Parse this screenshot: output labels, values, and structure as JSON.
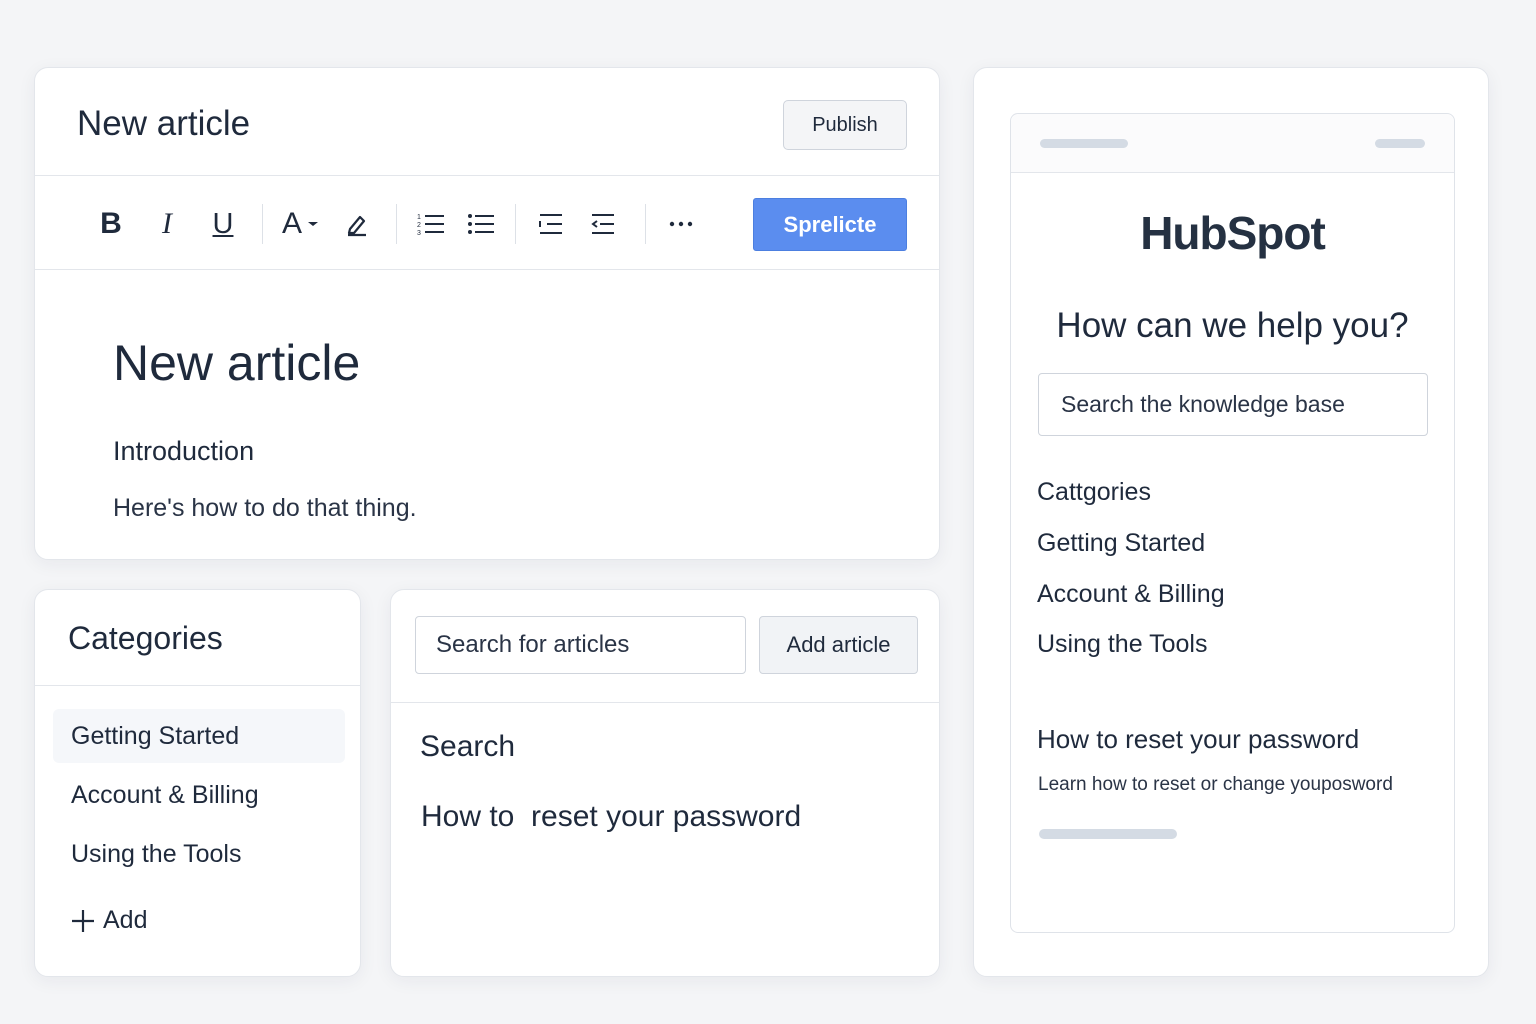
{
  "editor": {
    "header_title": "New article",
    "publish_label": "Publish",
    "primary_button_label": "Sprelicte",
    "toolbar": {
      "bold": "B",
      "italic": "I",
      "underline": "U",
      "font": "A",
      "icons": [
        "bold-icon",
        "italic-icon",
        "underline-icon",
        "font-color-icon",
        "highlight-icon",
        "ordered-list-icon",
        "bulleted-list-icon",
        "indent-icon",
        "outdent-icon",
        "more-icon"
      ]
    },
    "document": {
      "title": "New article",
      "heading": "Introduction",
      "paragraph": "Here's how to do that thing."
    }
  },
  "categories": {
    "title": "Categories",
    "items": [
      {
        "label": "Getting Started",
        "active": true
      },
      {
        "label": "Account & Billing",
        "active": false
      },
      {
        "label": "Using the Tools",
        "active": false
      }
    ],
    "add_label": "Add"
  },
  "search": {
    "placeholder": "Search for articles",
    "add_article_label": "Add article",
    "section_label": "Search",
    "result": "How to  reset your password"
  },
  "preview": {
    "logo_text": "HubSpot",
    "help_title": "How can we help you?",
    "kb_placeholder": "Search the knowledge base",
    "categories_title": "Cattgories",
    "categories": [
      "Getting Started",
      "Account & Billing",
      "Using the Tools"
    ],
    "article_title": "How to reset your password",
    "article_desc": "Learn how to reset or change youposword"
  },
  "colors": {
    "primary": "#5b8def",
    "text": "#1f2a3c",
    "border": "#e3e6eb",
    "background": "#f4f5f7",
    "brand_accent": "#ff5c35"
  }
}
